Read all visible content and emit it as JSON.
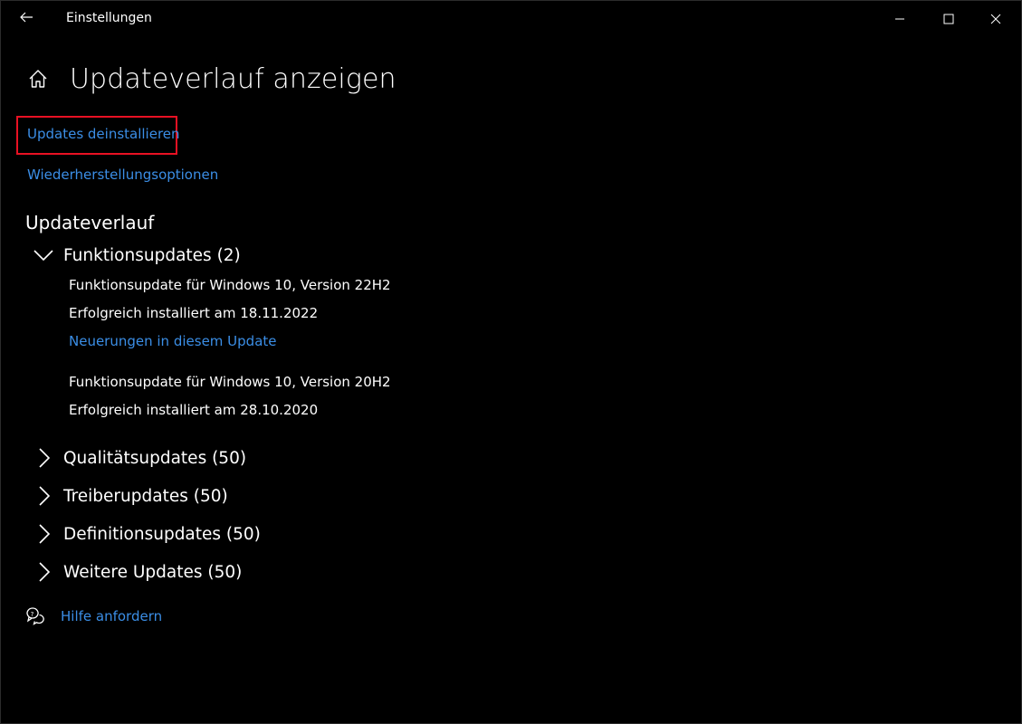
{
  "window": {
    "title": "Einstellungen"
  },
  "page": {
    "title": "Updateverlauf anzeigen"
  },
  "links": {
    "uninstall": "Updates deinstallieren",
    "recovery": "Wiederherstellungsoptionen"
  },
  "history": {
    "title": "Updateverlauf",
    "groups": [
      {
        "label": "Funktionsupdates (2)",
        "expanded": true,
        "items": [
          {
            "name": "Funktionsupdate für Windows 10, Version 22H2",
            "status": "Erfolgreich installiert am 18.11.2022",
            "link": "Neuerungen in diesem Update"
          },
          {
            "name": "Funktionsupdate für Windows 10, Version 20H2",
            "status": "Erfolgreich installiert am 28.10.2020"
          }
        ]
      },
      {
        "label": "Qualitätsupdates (50)",
        "expanded": false
      },
      {
        "label": "Treiberupdates (50)",
        "expanded": false
      },
      {
        "label": "Definitionsupdates (50)",
        "expanded": false
      },
      {
        "label": "Weitere Updates (50)",
        "expanded": false
      }
    ]
  },
  "help": {
    "label": "Hilfe anfordern"
  },
  "icons": {
    "back": "back-arrow-icon",
    "minimize": "minimize-icon",
    "maximize": "maximize-icon",
    "close": "close-icon",
    "home": "home-icon",
    "chevron_down": "chevron-down-icon",
    "chevron_right": "chevron-right-icon",
    "help": "help-chat-icon"
  },
  "colors": {
    "background": "#000000",
    "text": "#ffffff",
    "link": "#3b8ee6",
    "highlight": "#e81123"
  }
}
